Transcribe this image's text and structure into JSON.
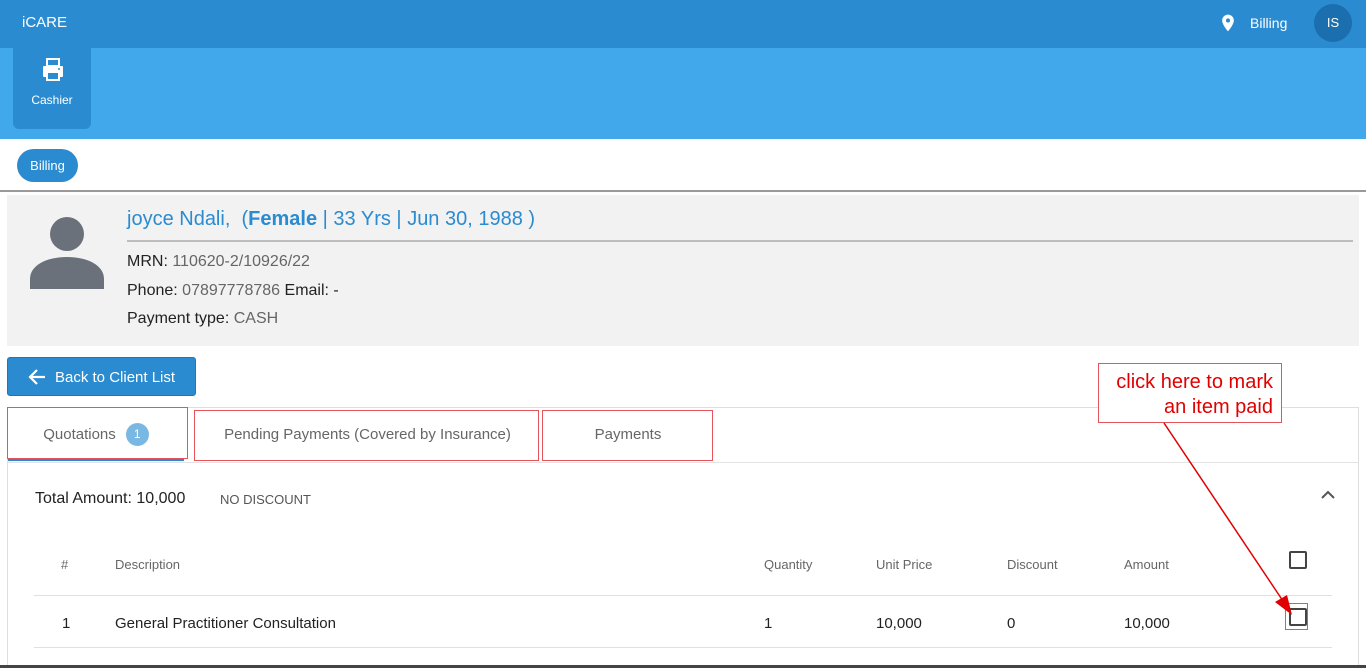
{
  "header": {
    "app_title": "iCARE",
    "location_label": "Billing",
    "user_initials": "IS"
  },
  "app_tiles": [
    {
      "label": "Cashier",
      "icon": "printer-icon"
    }
  ],
  "nav": {
    "active_pill": "Billing"
  },
  "patient": {
    "name": "joyce Ndali,",
    "gender": "Female",
    "age": "33 Yrs",
    "dob": "Jun 30, 1988",
    "mrn_label": "MRN:",
    "mrn": "110620-2/10926/22",
    "phone_label": "Phone:",
    "phone": "07897778786",
    "email_label": "Email:",
    "email": "-",
    "payment_type_label": "Payment type:",
    "payment_type": "CASH"
  },
  "back_button": {
    "label": "Back to Client List"
  },
  "tabs": [
    {
      "label": "Quotations",
      "badge": "1",
      "active": true
    },
    {
      "label": "Pending Payments (Covered by Insurance)"
    },
    {
      "label": "Payments"
    }
  ],
  "quotation": {
    "total_label": "Total Amount:",
    "total_value": "10,000",
    "discount_note": "NO DISCOUNT",
    "columns": [
      "#",
      "Description",
      "Quantity",
      "Unit Price",
      "Discount",
      "Amount"
    ],
    "rows": [
      {
        "num": "1",
        "description": "General Practitioner Consultation",
        "quantity": "1",
        "unit_price": "10,000",
        "discount": "0",
        "amount": "10,000"
      }
    ]
  },
  "annotation": {
    "line1": "click here to mark",
    "line2": "an item paid"
  },
  "colors": {
    "primary": "#2a8bd0",
    "appbar": "#42a8ec",
    "highlight": "#e5535b",
    "annotation_text": "#e00000"
  }
}
